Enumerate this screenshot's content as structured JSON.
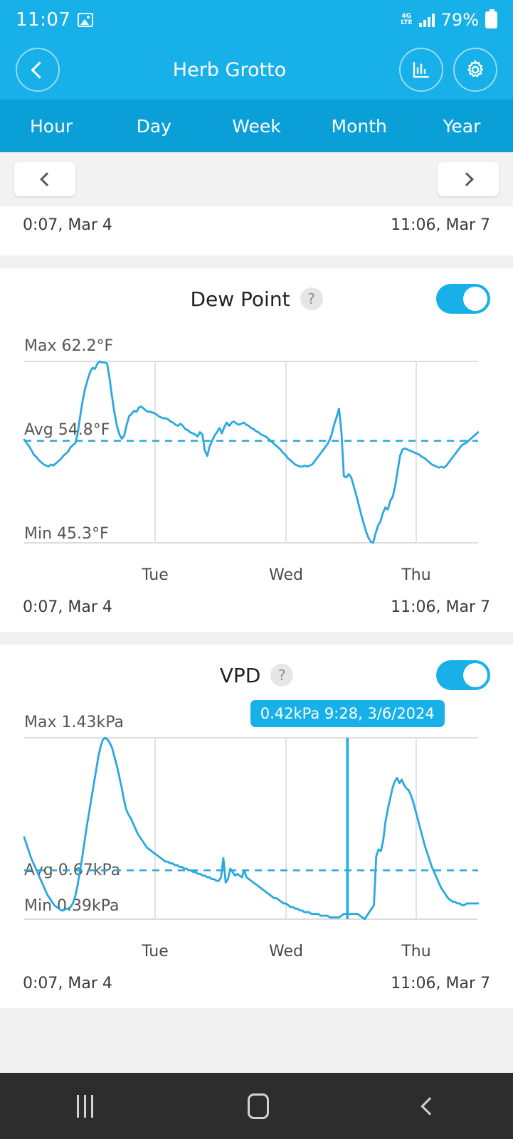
{
  "status_bar": {
    "time": "11:07",
    "battery_percent": "79%",
    "icons": [
      "image-icon",
      "lte-data-icon",
      "signal-bars-icon",
      "battery-icon"
    ],
    "network_label_top": "4G",
    "network_label_bottom": "LTE"
  },
  "app_bar": {
    "title": "Herb Grotto",
    "back_icon": "chevron-left-icon",
    "chart_icon": "bar-chart-icon",
    "settings_icon": "gear-icon"
  },
  "tabs": [
    {
      "label": "Hour"
    },
    {
      "label": "Day"
    },
    {
      "label": "Week"
    },
    {
      "label": "Month"
    },
    {
      "label": "Year"
    }
  ],
  "pager": {
    "prev_icon": "chevron-left-icon",
    "next_icon": "chevron-right-icon"
  },
  "range": {
    "start": "0:07, Mar 4",
    "end": "11:06, Mar 7"
  },
  "colors": {
    "accent": "#17b0e8",
    "tab_bar": "#0b9fd8",
    "line": "#29a8df",
    "page_bg": "#f0f0f0",
    "card_bg": "#ffffff",
    "nav_bg": "#2d2d2d"
  },
  "cards": [
    {
      "id": "partial-top-card",
      "start": "0:07, Mar 4",
      "end": "11:06, Mar 7"
    },
    {
      "id": "dew-point",
      "title": "Dew Point",
      "help": "?",
      "toggle_on": true,
      "max_label": "Max 62.2°F",
      "avg_label": "Avg 54.8°F",
      "min_label": "Min 45.3°F",
      "x_ticks": [
        "Tue",
        "Wed",
        "Thu"
      ],
      "start": "0:07, Mar 4",
      "end": "11:06, Mar 7"
    },
    {
      "id": "vpd",
      "title": "VPD",
      "help": "?",
      "toggle_on": true,
      "max_label": "Max 1.43kPa",
      "avg_label": "Avg 0.67kPa",
      "min_label": "Min 0.39kPa",
      "tooltip": "0.42kPa 9:28, 3/6/2024",
      "x_ticks": [
        "Tue",
        "Wed",
        "Thu"
      ],
      "start": "0:07, Mar 4",
      "end": "11:06, Mar 7"
    }
  ],
  "nav_bar": {
    "recents_icon": "recents-icon",
    "home_icon": "home-icon",
    "back_icon": "back-icon"
  },
  "chart_data": [
    {
      "type": "line",
      "title": "Dew Point",
      "ylabel": "°F",
      "xlabel": "",
      "unit": "°F",
      "max": 62.2,
      "avg": 54.8,
      "min": 45.3,
      "ylim": [
        45.3,
        62.2
      ],
      "grid": true,
      "legend": "none",
      "x_tick_labels": [
        "Tue",
        "Wed",
        "Thu"
      ],
      "x_tick_positions": [
        0.295,
        0.575,
        0.855
      ],
      "x_start": "0:07, Mar 4",
      "x_end": "11:06, Mar 7",
      "avg_line": 54.8,
      "values": [
        54.9,
        54.6,
        54.3,
        53.9,
        53.5,
        53.3,
        53.0,
        52.8,
        52.6,
        52.5,
        52.4,
        52.6,
        52.5,
        52.7,
        52.9,
        53.1,
        53.4,
        53.6,
        53.8,
        54.2,
        54.4,
        54.6,
        55.6,
        57.2,
        58.6,
        59.7,
        60.5,
        61.2,
        61.6,
        61.5,
        62.0,
        62.2,
        62.1,
        62.1,
        62.0,
        60.6,
        58.9,
        57.4,
        56.2,
        55.4,
        55.0,
        55.3,
        56.3,
        57.1,
        57.3,
        57.6,
        57.5,
        57.9,
        58.0,
        57.8,
        57.6,
        57.5,
        57.5,
        57.4,
        57.3,
        57.1,
        57.0,
        56.9,
        56.9,
        56.8,
        56.6,
        56.5,
        56.3,
        56.2,
        56.4,
        56.2,
        55.9,
        55.8,
        55.6,
        55.5,
        55.4,
        55.2,
        55.6,
        55.4,
        53.9,
        53.4,
        54.3,
        54.8,
        55.3,
        55.6,
        56.0,
        55.5,
        56.1,
        56.5,
        56.2,
        56.5,
        56.6,
        56.4,
        56.3,
        56.4,
        56.5,
        56.3,
        56.2,
        56.0,
        55.9,
        55.7,
        55.6,
        55.4,
        55.3,
        55.2,
        55.0,
        54.8,
        54.6,
        54.4,
        54.2,
        54.0,
        53.7,
        53.5,
        53.2,
        53.0,
        52.8,
        52.6,
        52.5,
        52.4,
        52.4,
        52.5,
        52.4,
        52.5,
        52.6,
        52.9,
        53.2,
        53.5,
        53.8,
        54.1,
        54.4,
        54.8,
        55.4,
        56.3,
        57.0,
        57.8,
        55.6,
        51.5,
        51.4,
        51.7,
        51.4,
        50.6,
        49.8,
        48.9,
        48.0,
        47.2,
        46.4,
        45.8,
        45.4,
        45.3,
        46.2,
        46.9,
        47.3,
        48.1,
        48.6,
        48.4,
        49.2,
        49.6,
        50.6,
        52.0,
        53.4,
        54.0,
        54.1,
        54.0,
        53.9,
        53.8,
        53.7,
        53.6,
        53.5,
        53.3,
        53.2,
        53.0,
        52.8,
        52.6,
        52.5,
        52.4,
        52.3,
        52.4,
        52.3,
        52.5,
        52.8,
        53.1,
        53.4,
        53.7,
        54.0,
        54.3,
        54.5,
        54.6,
        54.8,
        55.0,
        55.2,
        55.4,
        55.6
      ]
    },
    {
      "type": "line",
      "title": "VPD",
      "ylabel": "kPa",
      "xlabel": "",
      "unit": "kPa",
      "max": 1.43,
      "avg": 0.67,
      "min": 0.39,
      "ylim": [
        0.39,
        1.43
      ],
      "grid": true,
      "legend": "none",
      "x_tick_labels": [
        "Tue",
        "Wed",
        "Thu"
      ],
      "x_tick_positions": [
        0.295,
        0.575,
        0.855
      ],
      "x_start": "0:07, Mar 4",
      "x_end": "11:06, Mar 7",
      "avg_line": 0.67,
      "cursor": {
        "label": "0.42kPa 9:28, 3/6/2024",
        "x_fraction": 0.712,
        "value": 0.42
      },
      "values": [
        0.86,
        0.82,
        0.78,
        0.74,
        0.71,
        0.68,
        0.65,
        0.62,
        0.59,
        0.56,
        0.53,
        0.51,
        0.49,
        0.47,
        0.46,
        0.45,
        0.44,
        0.44,
        0.45,
        0.45,
        0.46,
        0.48,
        0.52,
        0.58,
        0.66,
        0.74,
        0.83,
        0.92,
        1.0,
        1.08,
        1.16,
        1.24,
        1.32,
        1.38,
        1.42,
        1.43,
        1.42,
        1.4,
        1.37,
        1.32,
        1.27,
        1.21,
        1.15,
        1.08,
        1.02,
        0.99,
        0.97,
        0.94,
        0.91,
        0.88,
        0.86,
        0.84,
        0.82,
        0.8,
        0.79,
        0.78,
        0.77,
        0.76,
        0.75,
        0.74,
        0.73,
        0.72,
        0.72,
        0.71,
        0.71,
        0.7,
        0.7,
        0.69,
        0.69,
        0.68,
        0.68,
        0.67,
        0.67,
        0.66,
        0.66,
        0.65,
        0.65,
        0.64,
        0.64,
        0.63,
        0.63,
        0.62,
        0.62,
        0.61,
        0.61,
        0.63,
        0.74,
        0.6,
        0.62,
        0.68,
        0.66,
        0.64,
        0.65,
        0.64,
        0.63,
        0.67,
        0.63,
        0.62,
        0.61,
        0.6,
        0.59,
        0.58,
        0.57,
        0.56,
        0.55,
        0.54,
        0.53,
        0.52,
        0.51,
        0.51,
        0.5,
        0.49,
        0.48,
        0.48,
        0.47,
        0.46,
        0.46,
        0.45,
        0.45,
        0.44,
        0.44,
        0.43,
        0.43,
        0.43,
        0.42,
        0.42,
        0.42,
        0.42,
        0.41,
        0.41,
        0.41,
        0.41,
        0.4,
        0.4,
        0.4,
        0.4,
        0.4,
        0.41,
        0.42,
        0.42,
        0.42,
        0.42,
        0.42,
        0.42,
        0.42,
        0.41,
        0.4,
        0.39,
        0.41,
        0.43,
        0.45,
        0.47,
        0.75,
        0.79,
        0.78,
        0.84,
        0.95,
        1.02,
        1.08,
        1.14,
        1.18,
        1.2,
        1.17,
        1.19,
        1.16,
        1.14,
        1.13,
        1.1,
        1.06,
        1.01,
        0.96,
        0.91,
        0.86,
        0.81,
        0.77,
        0.73,
        0.69,
        0.66,
        0.63,
        0.6,
        0.57,
        0.55,
        0.53,
        0.51,
        0.5,
        0.49,
        0.49,
        0.48,
        0.48,
        0.47,
        0.47,
        0.48,
        0.48,
        0.48,
        0.48,
        0.48,
        0.48
      ]
    }
  ]
}
